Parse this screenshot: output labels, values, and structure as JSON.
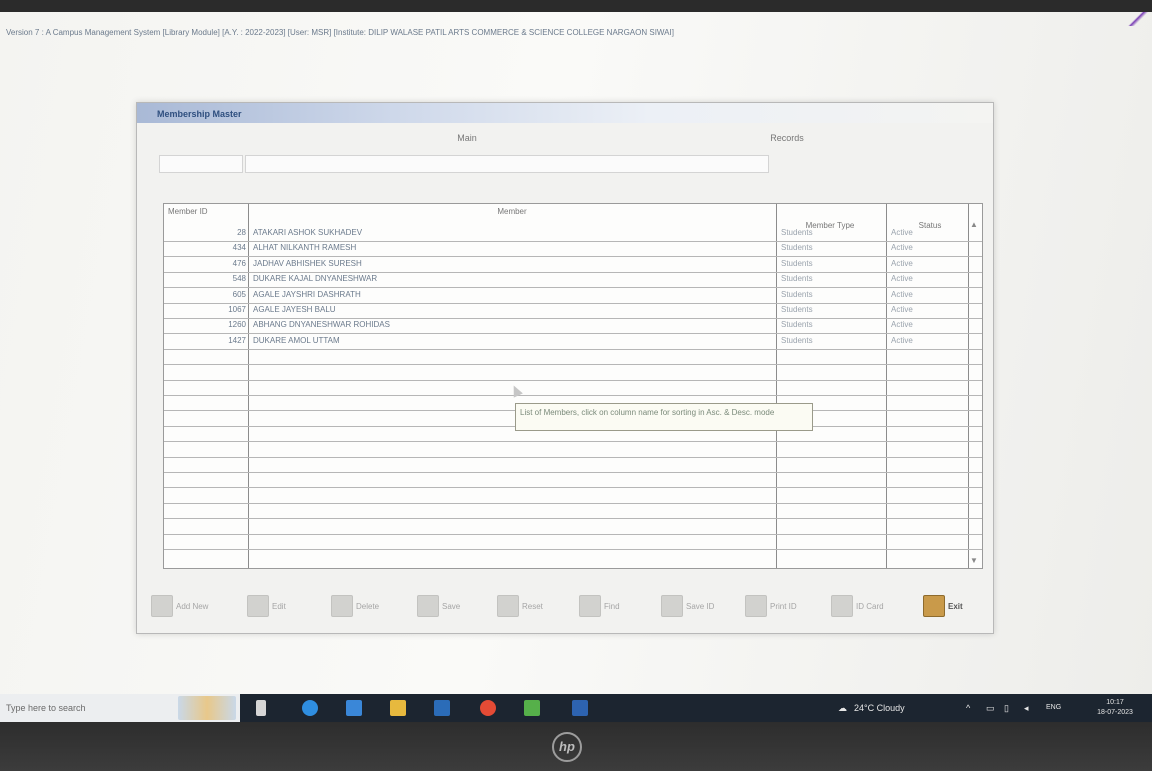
{
  "window": {
    "title": "Version 7 : A Campus Management System [Library Module] [A.Y. : 2022-2023] [User: MSR] [Institute: DILIP WALASE PATIL ARTS COMMERCE & SCIENCE COLLEGE NARGAON SIWAI]"
  },
  "dialog": {
    "title": "Membership Master",
    "tabs": [
      "Main",
      "Records"
    ]
  },
  "grid": {
    "columns": {
      "id": "Member ID",
      "name": "Member",
      "type": "Member Type",
      "status": "Status"
    },
    "rows": [
      {
        "id": "28",
        "name": "ATAKARI ASHOK SUKHADEV",
        "type": "Students",
        "status": "Active"
      },
      {
        "id": "434",
        "name": "ALHAT NILKANTH RAMESH",
        "type": "Students",
        "status": "Active"
      },
      {
        "id": "476",
        "name": "JADHAV ABHISHEK SURESH",
        "type": "Students",
        "status": "Active"
      },
      {
        "id": "548",
        "name": "DUKARE KAJAL DNYANESHWAR",
        "type": "Students",
        "status": "Active"
      },
      {
        "id": "605",
        "name": "AGALE JAYSHRI DASHRATH",
        "type": "Students",
        "status": "Active"
      },
      {
        "id": "1067",
        "name": "AGALE JAYESH BALU",
        "type": "Students",
        "status": "Active"
      },
      {
        "id": "1260",
        "name": "ABHANG DNYANESHWAR ROHIDAS",
        "type": "Students",
        "status": "Active"
      },
      {
        "id": "1427",
        "name": "DUKARE AMOL UTTAM",
        "type": "Students",
        "status": "Active"
      }
    ],
    "tooltip": "List of Members, click on column name for sorting in Asc. & Desc. mode"
  },
  "toolbar": {
    "buttons": [
      {
        "label": "Add New",
        "icon": "add-icon"
      },
      {
        "label": "Edit",
        "icon": "edit-icon"
      },
      {
        "label": "Delete",
        "icon": "delete-icon"
      },
      {
        "label": "Save",
        "icon": "save-icon"
      },
      {
        "label": "Reset",
        "icon": "reset-icon"
      },
      {
        "label": "Find",
        "icon": "find-icon"
      },
      {
        "label": "Save ID",
        "icon": "id-icon"
      },
      {
        "label": "Print ID",
        "icon": "print-id-icon"
      },
      {
        "label": "ID Card",
        "icon": "id-card-icon"
      }
    ],
    "exit_label": "Exit"
  },
  "taskbar": {
    "search_placeholder": "Type here to search",
    "weather": "24°C  Cloudy",
    "language": "ENG",
    "time": "10:17",
    "date": "18-07-2023"
  },
  "bezel": {
    "logo": "hp"
  },
  "colors": {
    "title_bar": "#a9b9d6",
    "taskbar": "#1c2530",
    "exit_button": "#c99a4a"
  }
}
